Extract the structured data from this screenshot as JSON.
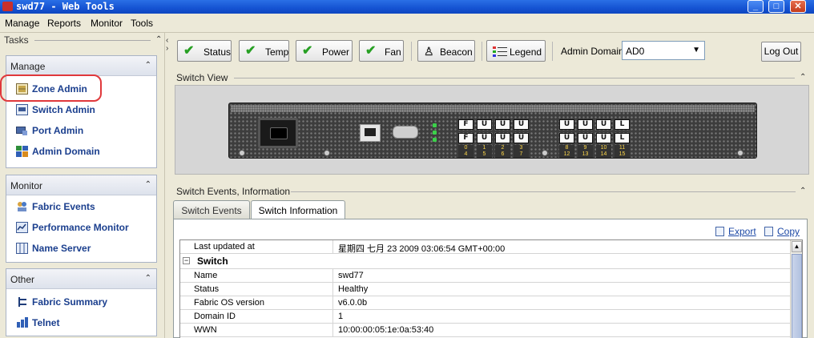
{
  "window": {
    "title": "swd77 - Web Tools",
    "buttons": {
      "minimize": "_",
      "maximize": "□",
      "close": "✕"
    }
  },
  "menu": {
    "items": [
      "Manage",
      "Reports",
      "Monitor",
      "Tools"
    ]
  },
  "tasks": {
    "label": "Tasks",
    "sections": [
      {
        "title": "Manage",
        "items": [
          {
            "label": "Zone Admin",
            "icon": "zone-admin-icon"
          },
          {
            "label": "Switch Admin",
            "icon": "switch-admin-icon"
          },
          {
            "label": "Port Admin",
            "icon": "port-admin-icon"
          },
          {
            "label": "Admin Domain",
            "icon": "admin-domain-icon"
          }
        ]
      },
      {
        "title": "Monitor",
        "items": [
          {
            "label": "Fabric Events",
            "icon": "fabric-events-icon"
          },
          {
            "label": "Performance Monitor",
            "icon": "performance-monitor-icon"
          },
          {
            "label": "Name Server",
            "icon": "name-server-icon"
          }
        ]
      },
      {
        "title": "Other",
        "items": [
          {
            "label": "Fabric Summary",
            "icon": "fabric-summary-icon"
          },
          {
            "label": "Telnet",
            "icon": "telnet-icon"
          }
        ]
      }
    ]
  },
  "toolbar": {
    "status": "Status",
    "temp": "Temp",
    "power": "Power",
    "fan": "Fan",
    "beacon": "Beacon",
    "legend": "Legend",
    "admin_domain_label": "Admin Domain",
    "admin_domain_value": "AD0",
    "logout": "Log Out"
  },
  "switch_view": {
    "title": "Switch View",
    "ports_top": [
      "F",
      "U",
      "U",
      "U",
      "U",
      "U",
      "U",
      "L"
    ],
    "ports_bottom": [
      "F",
      "U",
      "U",
      "U",
      "U",
      "U",
      "U",
      "L"
    ],
    "port_numbers": [
      "0",
      "1",
      "2",
      "3",
      "8",
      "9",
      "10",
      "11"
    ],
    "port_numbers_bottom": [
      "4",
      "5",
      "6",
      "7",
      "12",
      "13",
      "14",
      "15"
    ]
  },
  "events": {
    "title": "Switch Events, Information",
    "tabs": [
      "Switch Events",
      "Switch Information"
    ],
    "active_tab": "Switch Information",
    "export": "Export",
    "copy": "Copy",
    "rows": [
      {
        "key": "Last updated at",
        "value": "星期四 七月 23 2009 03:06:54 GMT+00:00"
      },
      {
        "group": "Switch",
        "toggle": "−"
      },
      {
        "key": "Name",
        "value": "swd77"
      },
      {
        "key": "Status",
        "value": "Healthy"
      },
      {
        "key": "Fabric OS version",
        "value": "v6.0.0b"
      },
      {
        "key": "Domain ID",
        "value": "1"
      },
      {
        "key": "WWN",
        "value": "10:00:00:05:1e:0a:53:40"
      }
    ]
  }
}
